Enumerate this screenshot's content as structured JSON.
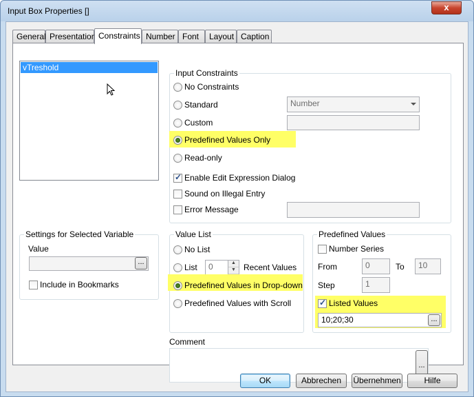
{
  "window": {
    "title": "Input Box Properties []",
    "close_glyph": "x"
  },
  "tabs": [
    "General",
    "Presentation",
    "Constraints",
    "Number",
    "Font",
    "Layout",
    "Caption"
  ],
  "active_tab": "Constraints",
  "variables": {
    "items": [
      "vTreshold"
    ],
    "selected": "vTreshold"
  },
  "input_constraints": {
    "title": "Input Constraints",
    "no_constraints": "No Constraints",
    "standard": "Standard",
    "standard_value": "Number",
    "custom": "Custom",
    "predefined_only": "Predefined Values Only",
    "read_only": "Read-only",
    "enable_edit_expression": "Enable Edit Expression Dialog",
    "sound_on_illegal": "Sound on Illegal Entry",
    "error_message": "Error Message"
  },
  "settings_selected_variable": {
    "title": "Settings for Selected Variable",
    "value_label": "Value",
    "value": "",
    "include_bookmarks": "Include in Bookmarks",
    "ellipsis": "..."
  },
  "value_list": {
    "title": "Value List",
    "no_list": "No List",
    "list": "List",
    "recent_count": "0",
    "recent_values": "Recent Values",
    "predefined_dropdown": "Predefined Values in Drop-down",
    "predefined_scroll": "Predefined Values with Scroll"
  },
  "predefined_values": {
    "title": "Predefined Values",
    "number_series": "Number Series",
    "from_label": "From",
    "from_value": "0",
    "to_label": "To",
    "to_value": "10",
    "step_label": "Step",
    "step_value": "1",
    "listed_values": "Listed Values",
    "listed_values_text": "10;20;30",
    "ellipsis": "..."
  },
  "comment": {
    "label": "Comment",
    "value": "",
    "ellipsis": "..."
  },
  "buttons": {
    "ok": "OK",
    "cancel": "Abbrechen",
    "apply": "Übernehmen",
    "help": "Hilfe"
  },
  "colors": {
    "highlight": "#ffff66",
    "selection": "#3399ff",
    "close_button": "#c8452e"
  }
}
